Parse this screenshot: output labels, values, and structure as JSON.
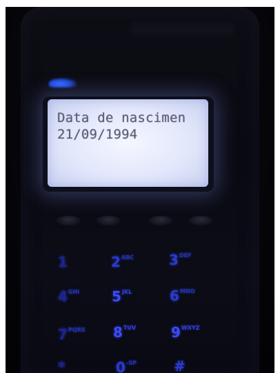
{
  "screen": {
    "line1": "Data de nascimen",
    "line2": "21/09/1994"
  },
  "keypad": {
    "keys": [
      {
        "digit": "1",
        "letters": ""
      },
      {
        "digit": "2",
        "letters": "ABC"
      },
      {
        "digit": "3",
        "letters": "DEF"
      },
      {
        "digit": "4",
        "letters": "GHI"
      },
      {
        "digit": "5",
        "letters": "JKL"
      },
      {
        "digit": "6",
        "letters": "MNO"
      },
      {
        "digit": "7",
        "letters": "PQRS"
      },
      {
        "digit": "8",
        "letters": "TUV"
      },
      {
        "digit": "9",
        "letters": "WXYZ"
      },
      {
        "digit": "*",
        "letters": ""
      },
      {
        "digit": "0",
        "letters": "-SP"
      },
      {
        "digit": "#",
        "letters": ""
      }
    ]
  },
  "colors": {
    "key_glow": "#2a3ad0",
    "lcd_backlight": "#e8ecff",
    "indicator_light": "#3a6dff"
  }
}
